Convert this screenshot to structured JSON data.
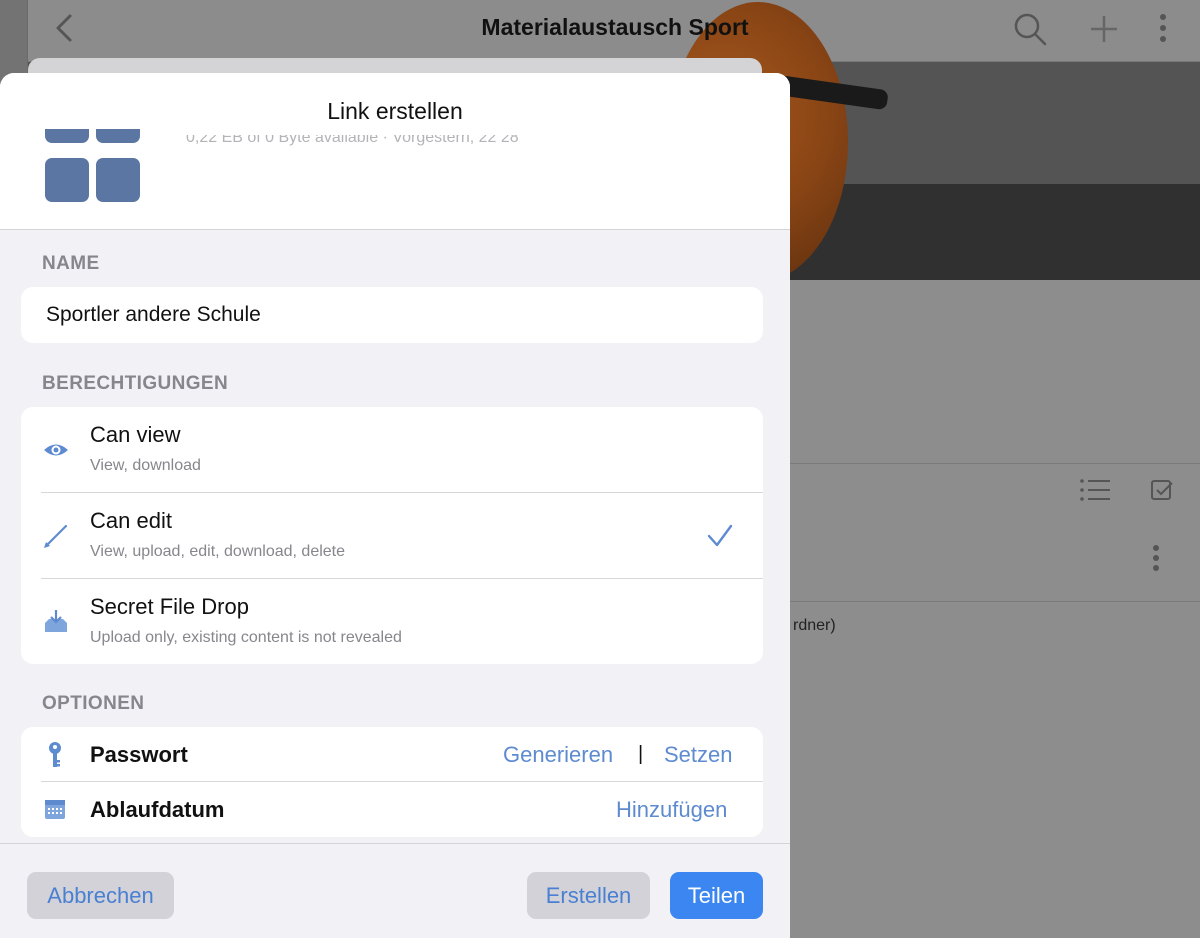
{
  "background": {
    "title": "Materialaustausch Sport",
    "partial_text": "rdner)"
  },
  "sheet": {
    "title": "Link erstellen",
    "folder_meta": "0,22 EB of 0 Byte available · Vorgestern, 22 28"
  },
  "name_section": {
    "label": "NAME",
    "value": "Sportler andere Schule"
  },
  "permissions_section": {
    "label": "BERECHTIGUNGEN",
    "items": [
      {
        "title": "Can view",
        "subtitle": "View, download",
        "icon": "eye-icon",
        "selected": false
      },
      {
        "title": "Can edit",
        "subtitle": "View, upload, edit, download, delete",
        "icon": "pencil-icon",
        "selected": true
      },
      {
        "title": "Secret File Drop",
        "subtitle": "Upload only, existing content is not revealed",
        "icon": "file-drop-icon",
        "selected": false
      }
    ]
  },
  "options_section": {
    "label": "OPTIONEN",
    "password": {
      "title": "Passwort",
      "generate": "Generieren",
      "separator": "|",
      "set": "Setzen"
    },
    "expiry": {
      "title": "Ablaufdatum",
      "add": "Hinzufügen"
    }
  },
  "footer": {
    "cancel": "Abbrechen",
    "create": "Erstellen",
    "share": "Teilen"
  },
  "colors": {
    "accent": "#5e8bd0",
    "primary_button": "#3b86f0",
    "icon_blue": "#5c76a3"
  }
}
